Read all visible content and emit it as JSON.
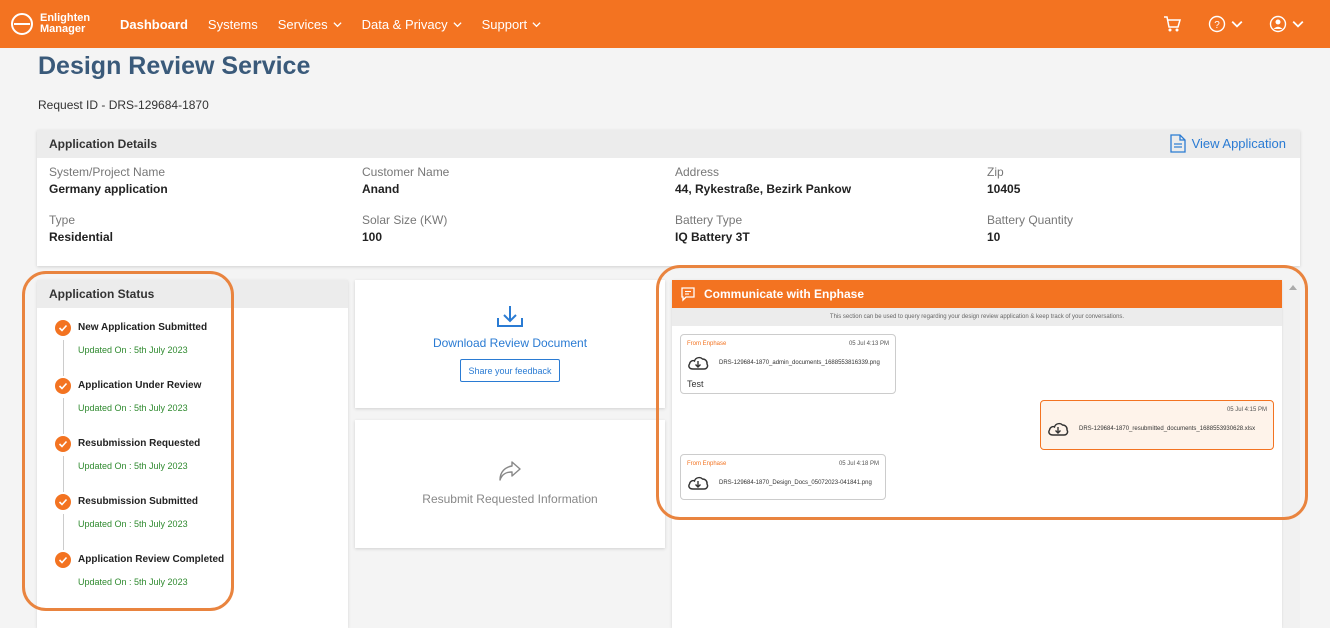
{
  "nav": {
    "brand_line1": "Enlighten",
    "brand_line2": "Manager",
    "items": [
      {
        "label": "Dashboard"
      },
      {
        "label": "Systems"
      },
      {
        "label": "Services"
      },
      {
        "label": "Data & Privacy"
      },
      {
        "label": "Support"
      }
    ]
  },
  "page": {
    "title": "Design Review Service",
    "request_id": "Request ID - DRS-129684-1870"
  },
  "details": {
    "header": "Application Details",
    "view_application": "View Application",
    "fields": [
      {
        "label": "System/Project Name",
        "value": "Germany application"
      },
      {
        "label": "Customer Name",
        "value": "Anand"
      },
      {
        "label": "Address",
        "value": "44, Rykestraße, Bezirk Pankow"
      },
      {
        "label": "Zip",
        "value": "10405"
      },
      {
        "label": "Type",
        "value": "Residential"
      },
      {
        "label": "Solar Size (KW)",
        "value": "100"
      },
      {
        "label": "Battery Type",
        "value": "IQ Battery 3T"
      },
      {
        "label": "Battery Quantity",
        "value": "10"
      }
    ]
  },
  "status": {
    "header": "Application Status",
    "steps": [
      {
        "name": "New Application Submitted",
        "updated": "Updated On : 5th July 2023"
      },
      {
        "name": "Application Under Review",
        "updated": "Updated On : 5th July 2023"
      },
      {
        "name": "Resubmission Requested",
        "updated": "Updated On : 5th July 2023"
      },
      {
        "name": "Resubmission Submitted",
        "updated": "Updated On : 5th July 2023"
      },
      {
        "name": "Application Review Completed",
        "updated": "Updated On : 5th July 2023"
      }
    ]
  },
  "actions": {
    "download_label": "Download Review Document",
    "feedback_label": "Share your feedback",
    "resubmit_label": "Resubmit Requested Information"
  },
  "comm": {
    "header": "Communicate with Enphase",
    "note": "This section can be used to query regarding your design review application & keep track of your conversations.",
    "messages": [
      {
        "from": "From Enphase",
        "time": "05 Jul 4:13 PM",
        "file": "DRS-129684-1870_admin_documents_1688553816339.png",
        "text": "Test"
      },
      {
        "from": "",
        "time": "05 Jul 4:15 PM",
        "file": "DRS-129684-1870_resubmitted_documents_1688553930628.xlsx",
        "text": ""
      },
      {
        "from": "From Enphase",
        "time": "05 Jul 4:18 PM",
        "file": "DRS-129684-1870_Design_Docs_05072023-041841.png",
        "text": ""
      }
    ]
  },
  "colors": {
    "brand": "#f37321",
    "link": "#2a7bd3",
    "title": "#3a5a7a",
    "success": "#2f8a2f",
    "highlight": "#e9843f"
  }
}
